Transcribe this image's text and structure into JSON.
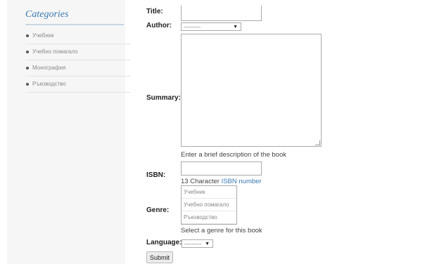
{
  "sidebar": {
    "title": "Categories",
    "items": [
      {
        "label": "Учебник"
      },
      {
        "label": "Учебно помагало"
      },
      {
        "label": "Монография"
      },
      {
        "label": "Ръководство"
      }
    ]
  },
  "form": {
    "title_label": "Title:",
    "author_label": "Author:",
    "author_value": "---------",
    "summary_label": "Summary:",
    "summary_help": "Enter a brief description of the book",
    "isbn_label": "ISBN:",
    "isbn_help_prefix": "13 Character ",
    "isbn_help_link": "ISBN number",
    "genre_label": "Genre:",
    "genre_options": [
      {
        "label": "Учебник"
      },
      {
        "label": "Учебно помагало"
      },
      {
        "label": "Ръководство"
      }
    ],
    "genre_help": "Select a genre for this book",
    "language_label": "Language:",
    "language_value": "---------",
    "submit_label": "Submit"
  }
}
